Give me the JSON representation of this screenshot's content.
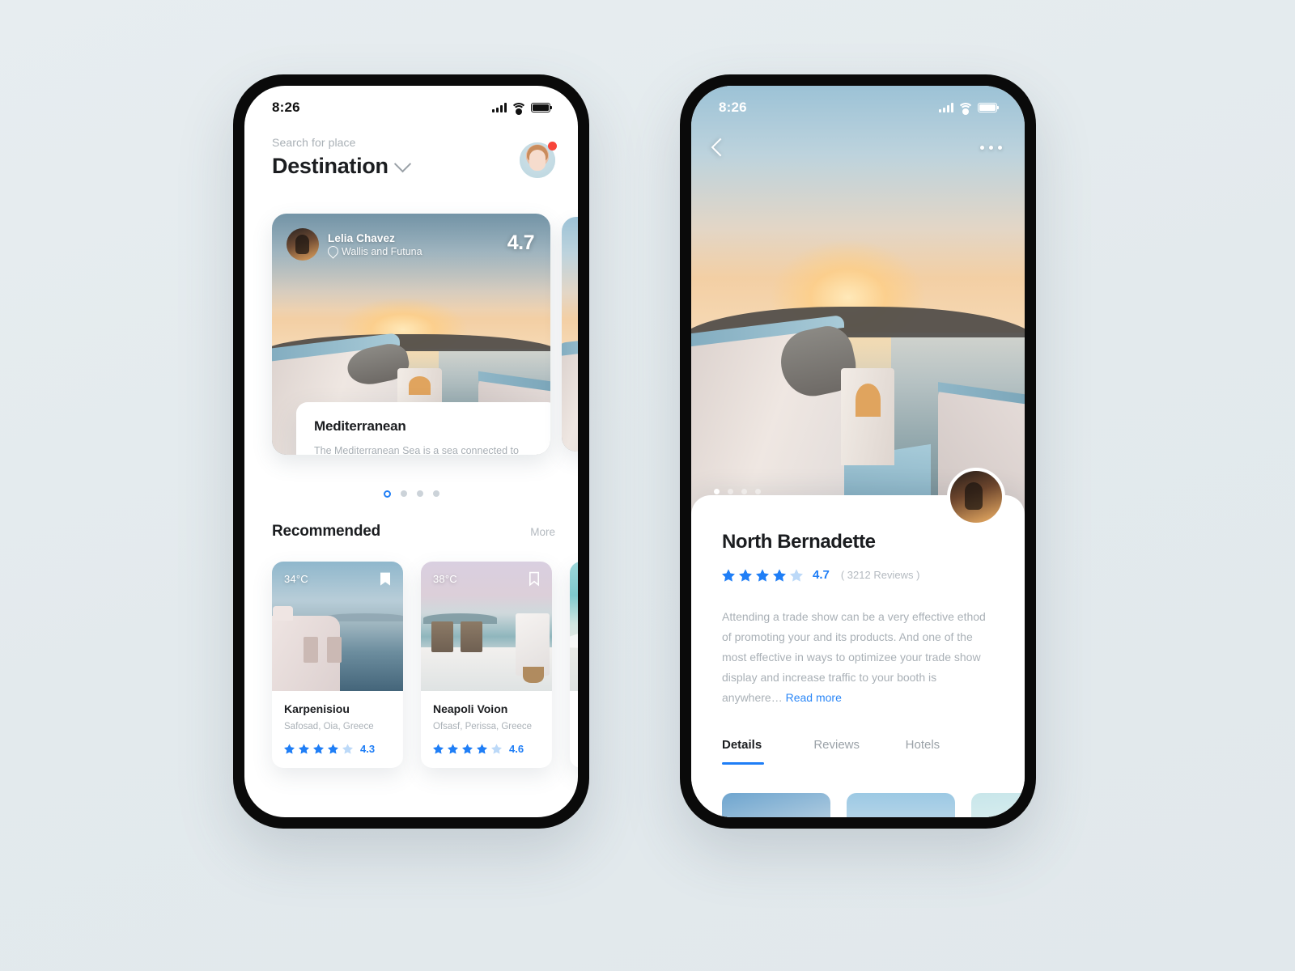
{
  "background_color": "#e5ebee",
  "accent_color": "#1f7ef6",
  "phone_left": {
    "status_bar": {
      "time": "8:26",
      "icons": [
        "signal-bars-icon",
        "wifi-icon",
        "battery-icon"
      ]
    },
    "header": {
      "search_label": "Search for place",
      "title": "Destination",
      "dropdown_icon": "chevron-down-icon",
      "avatar": {
        "name": "profile-avatar",
        "has_notification": true,
        "notification_color": "#f8453a"
      }
    },
    "hero_card": {
      "user_name": "Lelia Chavez",
      "location": "Wallis and Futuna",
      "location_icon": "map-pin-icon",
      "score": "4.7",
      "info": {
        "title": "Mediterranean",
        "description": "The Mediterranean Sea is a sea connected to the Atlantic Ocean…",
        "arrow_icon": "chevron-right-icon"
      }
    },
    "carousel": {
      "total": 4,
      "active_index": 0
    },
    "recommended": {
      "title": "Recommended",
      "more_label": "More",
      "cards": [
        {
          "temperature": "34°C",
          "bookmark_icon": "bookmark-filled-icon",
          "bookmarked": true,
          "name": "Karpenisiou",
          "address": "Safosad, Oia, Greece",
          "rating": "4.3",
          "stars_filled": 4,
          "stars_total": 5
        },
        {
          "temperature": "38°C",
          "bookmark_icon": "bookmark-outline-icon",
          "bookmarked": false,
          "name": "Neapoli Voion",
          "address": "Ofsasf, Perissa, Greece",
          "rating": "4.6",
          "stars_filled": 4,
          "stars_total": 5
        },
        {
          "temperature": "",
          "bookmark_icon": "bookmark-outline-icon",
          "bookmarked": false,
          "name": "",
          "address": "",
          "rating": "",
          "stars_filled": 0,
          "stars_total": 5
        }
      ]
    }
  },
  "phone_right": {
    "status_bar": {
      "time": "8:26",
      "icons": [
        "signal-bars-icon",
        "wifi-icon",
        "battery-icon"
      ]
    },
    "topbar": {
      "back_icon": "back-chevron-icon",
      "menu_icon": "more-horizontal-icon"
    },
    "hero_carousel": {
      "total": 4,
      "active_index": 0
    },
    "guide_avatar": "guide-avatar",
    "detail": {
      "title": "North Bernadette",
      "rating": "4.7",
      "stars_filled": 4,
      "stars_total": 5,
      "reviews": "( 3212 Reviews )",
      "description": "Attending a trade show can be a very effective ethod of promoting your and its products. And one of the most effective in ways to optimizee your trade show display and increase traffic to your booth is anywhere…",
      "read_more": "Read more"
    },
    "tabs": [
      {
        "label": "Details",
        "active": true
      },
      {
        "label": "Reviews",
        "active": false
      },
      {
        "label": "Hotels",
        "active": false
      }
    ],
    "gallery": [
      {
        "name": "gallery-thumb-1"
      },
      {
        "name": "gallery-thumb-2"
      },
      {
        "name": "gallery-thumb-3"
      }
    ]
  }
}
